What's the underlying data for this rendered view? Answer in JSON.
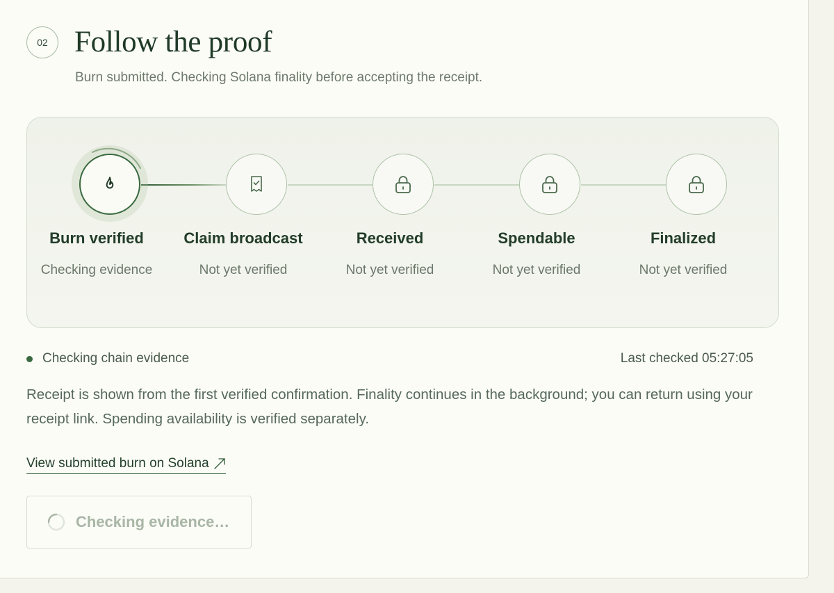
{
  "header": {
    "step_number": "02",
    "title": "Follow the proof",
    "subtitle": "Burn submitted. Checking Solana finality before accepting the receipt."
  },
  "steps": [
    {
      "label": "Burn verified",
      "status": "Checking evidence",
      "icon": "flame-icon",
      "active": true
    },
    {
      "label": "Claim broadcast",
      "status": "Not yet verified",
      "icon": "receipt-check-icon",
      "active": false
    },
    {
      "label": "Received",
      "status": "Not yet verified",
      "icon": "lock-icon",
      "active": false
    },
    {
      "label": "Spendable",
      "status": "Not yet verified",
      "icon": "lock-icon",
      "active": false
    },
    {
      "label": "Finalized",
      "status": "Not yet verified",
      "icon": "lock-icon",
      "active": false
    }
  ],
  "status_bar": {
    "live_text": "Checking chain evidence",
    "last_checked": "Last checked 05:27:05"
  },
  "explanation": "Receipt is shown from the first verified confirmation. Finality continues in the background; you can return using your receipt link. Spending availability is verified separately.",
  "explorer_link": {
    "label": "View submitted burn on Solana",
    "icon": "external-arrow-icon"
  },
  "action_button": {
    "label": "Checking evidence…",
    "icon": "spinner-icon",
    "disabled": true
  },
  "colors": {
    "accent": "#3a6a3f",
    "title": "#1f3a26",
    "muted": "#6b786a",
    "panel_border": "#cfdcc9",
    "page_bg": "#fcfcf7"
  }
}
